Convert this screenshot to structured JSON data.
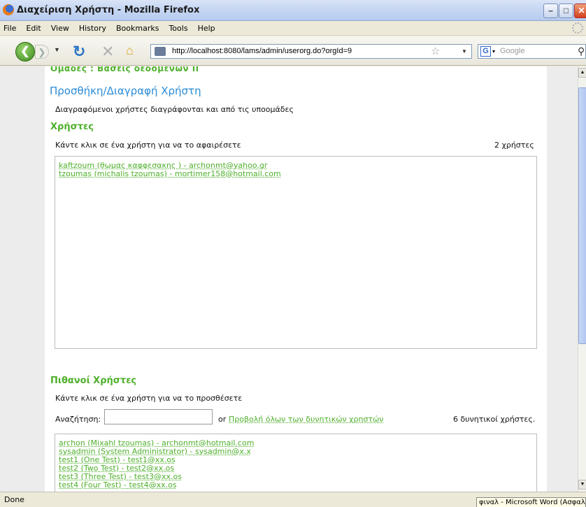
{
  "window": {
    "title": "Διαχείριση Χρήστη - Mozilla Firefox"
  },
  "menu": [
    "File",
    "Edit",
    "View",
    "History",
    "Bookmarks",
    "Tools",
    "Help"
  ],
  "nav": {
    "url": "http://localhost:8080/lams/admin/userorg.do?orgId=9",
    "search_placeholder": "Google"
  },
  "page": {
    "breadcrumb": "Ομάδες : Βάσεις δεδομένων II",
    "heading": "Προσθήκη/Διαγραφή Χρήστη",
    "description": "Διαγραφόμενοι χρήστες διαγράφονται και από τις υποομάδες",
    "users": {
      "heading": "Χρήστες",
      "hint": "Κάντε κλικ σε ένα χρήστη για να το αφαιρέσετε",
      "count": "2 χρήστες",
      "items": [
        "kaftzoum (θωμας καφφεσακης ) - archonmt@yahoo.gr",
        "tzoumas (michalis tzoumas) - mortimer158@hotmail.com"
      ]
    },
    "potential": {
      "heading": "Πιθανοί Χρήστες",
      "hint": "Κάντε κλικ σε ένα χρήστη για να το προσθέσετε",
      "search_label": "Αναζήτηση:",
      "search_value": "",
      "or": "or",
      "show_all": "Προβολή όλων των δυνητικών χρηστών",
      "count": "6 δυνητικοί χρήστες.",
      "items": [
        "archon (Mixahl tzoumas) - archonmt@hotmail.com",
        "sysadmin (System Administrator) - sysadmin@x.x",
        "test1 (One Test) - test1@xx.os",
        "test2 (Two Test) - test2@xx.os",
        "test3 (Three Test) - test3@xx.os",
        "test4 (Four Test) - test4@xx.os"
      ]
    }
  },
  "status": {
    "text": "Done",
    "taskbar": "φιναλ - Microsoft Word (Ασφαλής λειτουργία)"
  },
  "colors": {
    "accent_green": "#4eb02b",
    "heading_blue": "#2b8bd6"
  }
}
